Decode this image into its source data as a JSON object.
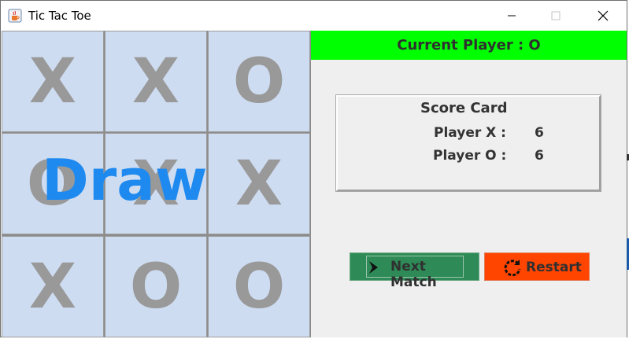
{
  "window": {
    "title": "Tic Tac Toe",
    "controls": {
      "minimize": "—",
      "maximize": "☐",
      "close": "✕"
    }
  },
  "board": {
    "cells": [
      "X",
      "X",
      "O",
      "O",
      "X",
      "X",
      "X",
      "O",
      "O"
    ],
    "overlay": "Draw"
  },
  "status": {
    "current_player": "Current Player : O"
  },
  "scorecard": {
    "title": "Score Card",
    "players": [
      {
        "label": "Player X :",
        "score": "6"
      },
      {
        "label": "Player O :",
        "score": "6"
      }
    ]
  },
  "buttons": {
    "next_match": "Next Match",
    "restart": "Restart"
  },
  "colors": {
    "status_bar": "#00ff00",
    "cell": "#cedcf1",
    "mark": "#999999",
    "overlay": "#1e8af0",
    "next_button": "#2e8b57",
    "restart_button": "#ff4500"
  }
}
